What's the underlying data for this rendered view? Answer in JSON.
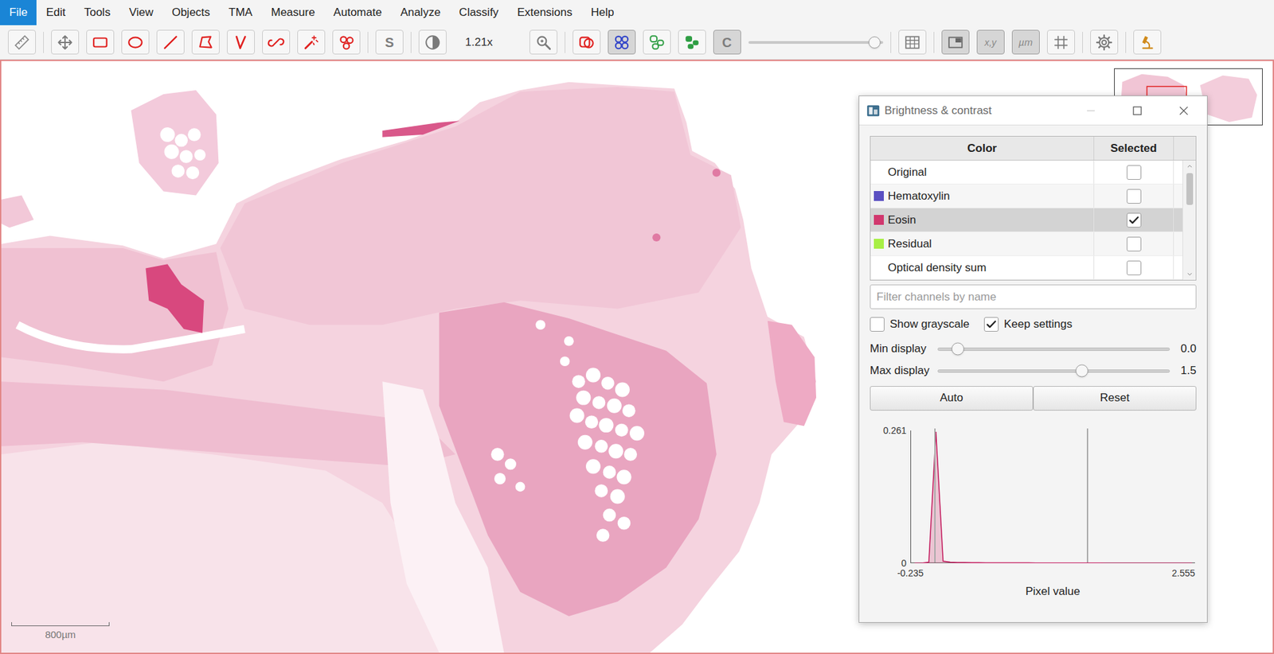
{
  "menu": {
    "items": [
      {
        "label": "File",
        "selected": true
      },
      {
        "label": "Edit",
        "selected": false
      },
      {
        "label": "Tools",
        "selected": false
      },
      {
        "label": "View",
        "selected": false
      },
      {
        "label": "Objects",
        "selected": false
      },
      {
        "label": "TMA",
        "selected": false
      },
      {
        "label": "Measure",
        "selected": false
      },
      {
        "label": "Automate",
        "selected": false
      },
      {
        "label": "Analyze",
        "selected": false
      },
      {
        "label": "Classify",
        "selected": false
      },
      {
        "label": "Extensions",
        "selected": false
      },
      {
        "label": "Help",
        "selected": false
      }
    ]
  },
  "toolbar": {
    "items": [
      {
        "kind": "button",
        "selected": false
      },
      {
        "kind": "separator"
      },
      {
        "kind": "button",
        "selected": false
      },
      {
        "kind": "button",
        "selected": false
      },
      {
        "kind": "button",
        "selected": false
      },
      {
        "kind": "button",
        "selected": false
      },
      {
        "kind": "button",
        "selected": false
      },
      {
        "kind": "button",
        "selected": false
      },
      {
        "kind": "button",
        "selected": false
      },
      {
        "kind": "button",
        "selected": false
      },
      {
        "kind": "button",
        "selected": false
      },
      {
        "kind": "separator"
      },
      {
        "kind": "button",
        "label": "S",
        "selected": false
      },
      {
        "kind": "separator"
      },
      {
        "kind": "button",
        "selected": false
      },
      {
        "kind": "label",
        "label": "1.21x"
      },
      {
        "kind": "button",
        "selected": false
      },
      {
        "kind": "separator"
      },
      {
        "kind": "button",
        "selected": false
      },
      {
        "kind": "button",
        "selected": true
      },
      {
        "kind": "button",
        "selected": false
      },
      {
        "kind": "button",
        "selected": false
      },
      {
        "kind": "button",
        "label": "C",
        "selected": true
      },
      {
        "kind": "slider",
        "level": 0.94
      },
      {
        "kind": "separator"
      },
      {
        "kind": "button",
        "selected": false
      },
      {
        "kind": "separator"
      },
      {
        "kind": "button",
        "selected": true
      },
      {
        "kind": "button",
        "label": "x,y",
        "selected": true
      },
      {
        "kind": "button",
        "label": "µm",
        "selected": true
      },
      {
        "kind": "button",
        "selected": false
      },
      {
        "kind": "separator"
      },
      {
        "kind": "button",
        "selected": false
      },
      {
        "kind": "separator"
      },
      {
        "kind": "button",
        "selected": false
      }
    ]
  },
  "viewer": {
    "scale_bar": {
      "label": "800µm"
    }
  },
  "dialog": {
    "title": "Brightness & contrast",
    "table": {
      "columns": [
        "Color",
        "Selected"
      ],
      "rows": [
        {
          "name": "Original",
          "selected": false,
          "checked": false
        },
        {
          "name": "Hematoxylin",
          "color": "#5a4fc2",
          "selected": false,
          "checked": false
        },
        {
          "name": "Eosin",
          "color": "#d1386e",
          "selected": true,
          "checked": true
        },
        {
          "name": "Residual",
          "color": "#a8ef45",
          "selected": false,
          "checked": false
        },
        {
          "name": "Optical density sum",
          "selected": false,
          "checked": false
        }
      ]
    },
    "filter": {
      "placeholder": "Filter channels by name"
    },
    "checkboxes": [
      {
        "label": "Show grayscale",
        "checked": false
      },
      {
        "label": "Keep settings",
        "checked": true
      }
    ],
    "sliders": [
      {
        "label": "Min display",
        "level": 0.084,
        "reading": "0.0"
      },
      {
        "label": "Max display",
        "level": 0.622,
        "reading": "1.5"
      }
    ],
    "buttons": [
      "Auto",
      "Reset"
    ],
    "histogram": {
      "y_max": 0.261,
      "y_ticks": [
        "0.261",
        "0"
      ],
      "x_ticks": [
        "-0.235",
        "2.555"
      ],
      "x_title": "Pixel value",
      "values": [
        0,
        0,
        0.002,
        0.261,
        0.004,
        0.002,
        0.0015,
        0.0012,
        0.001,
        0.001,
        0.0008,
        0.0008,
        0.0007,
        0.0006,
        0.0006,
        0.0005,
        0.0005,
        0.0004,
        0.0004,
        0.0004,
        0.0003,
        0.0003,
        0.0003,
        0.0002,
        0.0002,
        0.0002,
        0.0002,
        0.0001,
        0.0001,
        0.0001,
        0.0001,
        0.0001,
        0,
        0,
        0,
        0,
        0,
        0,
        0,
        0
      ]
    }
  }
}
